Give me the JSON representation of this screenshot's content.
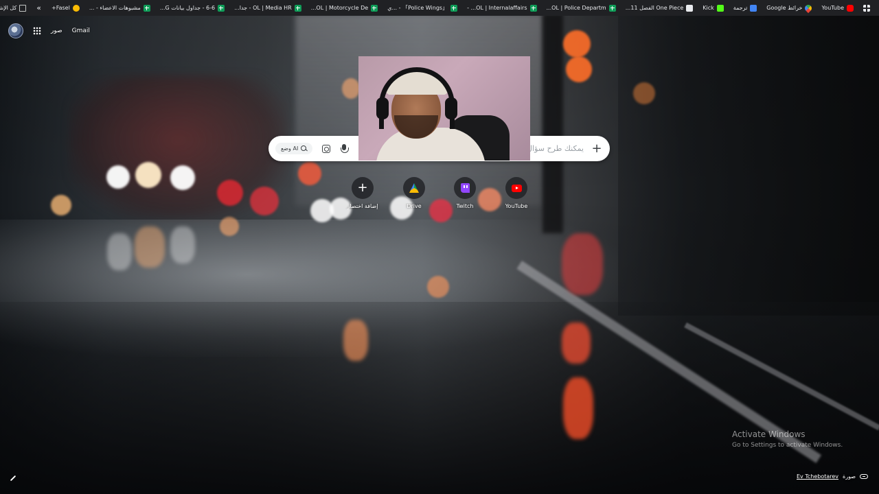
{
  "bookmarks": {
    "apps_label": "",
    "items": [
      {
        "label": "YouTube",
        "icon": "youtube-icon"
      },
      {
        "label": "خرائط Google",
        "icon": "maps-icon"
      },
      {
        "label": "ترجمة",
        "icon": "translate-icon"
      },
      {
        "label": "Kick",
        "icon": "kick-icon"
      },
      {
        "label": "One Piece الفصل 11...",
        "icon": "onepiece-icon"
      },
      {
        "label": "OL | Police Departm...",
        "icon": "sheet-icon"
      },
      {
        "label": "OL | Internalaffairs... -",
        "icon": "sheet-icon"
      },
      {
        "label": "「Police Wings」 - ...ي",
        "icon": "sheet-icon"
      },
      {
        "label": "OL | Motorcycle De...",
        "icon": "sheet-icon"
      },
      {
        "label": "OL | Media HR - جدا...",
        "icon": "sheet-icon"
      },
      {
        "label": "6-6 - جداول بيانات G...",
        "icon": "sheet-icon"
      },
      {
        "label": "مشبوهات الاعضاء - ...",
        "icon": "sheet-icon"
      },
      {
        "label": "Fasel+",
        "icon": "fasel-icon"
      }
    ],
    "more": "»",
    "all_bookmarks": "كل الإشارات المرجعية"
  },
  "top": {
    "gmail": "Gmail",
    "images": "صور"
  },
  "search": {
    "placeholder": "يمكنك طرح سؤال",
    "ai_mode": "وضع AI"
  },
  "shortcuts": [
    {
      "label": "إضافة اختصار",
      "icon": "plus-icon"
    },
    {
      "label": "Drive",
      "icon": "drive-icon"
    },
    {
      "label": "Twitch",
      "icon": "twitch-icon"
    },
    {
      "label": "YouTube",
      "icon": "youtube-icon"
    }
  ],
  "watermark": {
    "title": "Activate Windows",
    "subtitle": "Go to Settings to activate Windows."
  },
  "credit": {
    "prefix": "صورة",
    "name": "Ev Tchebotarev"
  },
  "colors": {
    "bookmarks_bg": "#202124",
    "search_bg": "#ffffff",
    "shortcut_bg": "#202124",
    "twitch": "#9146ff",
    "youtube": "#ff0000"
  }
}
